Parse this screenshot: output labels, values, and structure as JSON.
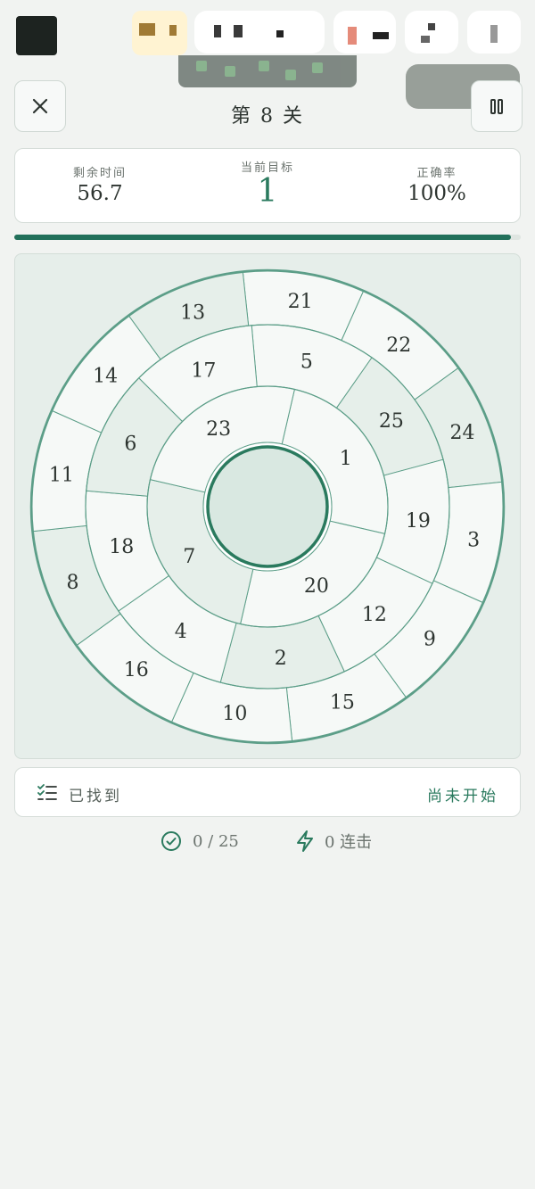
{
  "level": {
    "title": "第 8 关"
  },
  "stats": [
    {
      "label": "剩余时间",
      "value": "56.7"
    },
    {
      "label": "当前目标",
      "value": "1"
    },
    {
      "label": "正确率",
      "value": "100%"
    }
  ],
  "progress": {
    "time_remaining_fraction": 0.98
  },
  "board": {
    "ring_inner": [
      "1",
      "20",
      "7",
      "23"
    ],
    "ring_middle": [
      "5",
      "25",
      "19",
      "12",
      "2",
      "4",
      "18",
      "6",
      "17"
    ],
    "ring_outer": [
      "21",
      "22",
      "24",
      "3",
      "9",
      "15",
      "10",
      "16",
      "8",
      "11",
      "14",
      "13"
    ],
    "highlighted_cells": [
      "25",
      "7",
      "2",
      "24",
      "6",
      "13",
      "8"
    ]
  },
  "found": {
    "label": "已找到",
    "status": "尚未开始"
  },
  "footer": {
    "found_count": "0 / 25",
    "combo": "0 连击"
  },
  "colors": {
    "accent": "#2a7a5e",
    "ring_stroke": "#5c9e88",
    "cell_fill": "#f6f9f7",
    "cell_shaded": "#e6efea",
    "center_fill": "#d9e8e1"
  },
  "icons": {
    "close": "close-icon",
    "pause": "pause-icon",
    "checklist": "checklist-icon",
    "check_circle": "check-circle-icon",
    "bolt": "bolt-icon"
  }
}
